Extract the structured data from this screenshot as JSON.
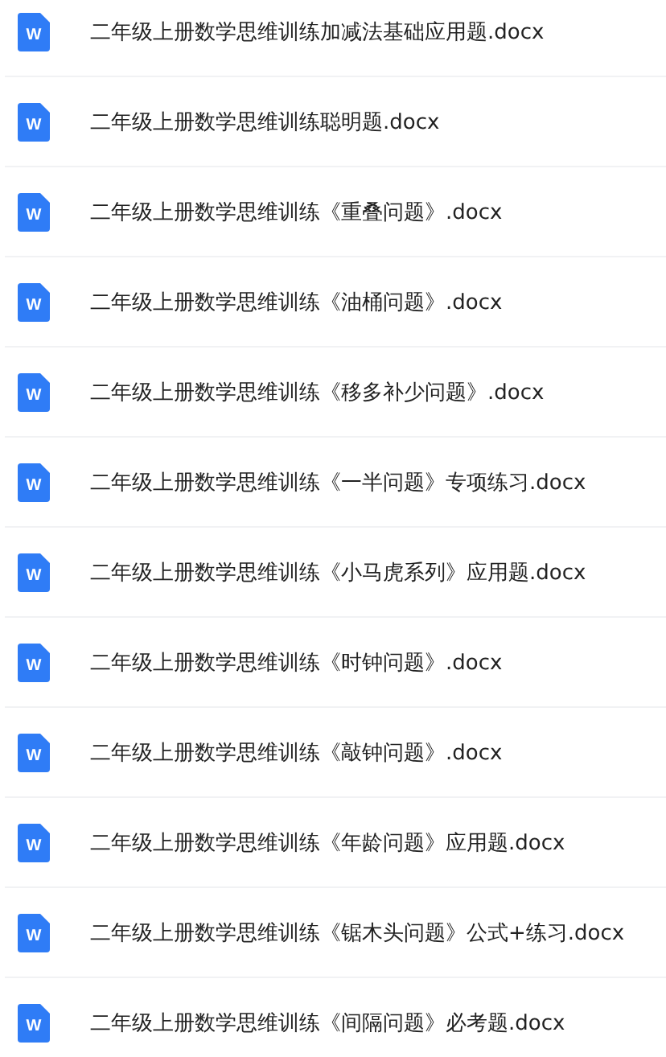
{
  "files": [
    {
      "icon_label": "W",
      "name": "二年级上册数学思维训练加减法基础应用题.docx"
    },
    {
      "icon_label": "W",
      "name": "二年级上册数学思维训练聪明题.docx"
    },
    {
      "icon_label": "W",
      "name": "二年级上册数学思维训练《重叠问题》.docx"
    },
    {
      "icon_label": "W",
      "name": "二年级上册数学思维训练《油桶问题》.docx"
    },
    {
      "icon_label": "W",
      "name": "二年级上册数学思维训练《移多补少问题》.docx"
    },
    {
      "icon_label": "W",
      "name": "二年级上册数学思维训练《一半问题》专项练习.docx"
    },
    {
      "icon_label": "W",
      "name": "二年级上册数学思维训练《小马虎系列》应用题.docx"
    },
    {
      "icon_label": "W",
      "name": "二年级上册数学思维训练《时钟问题》.docx"
    },
    {
      "icon_label": "W",
      "name": "二年级上册数学思维训练《敲钟问题》.docx"
    },
    {
      "icon_label": "W",
      "name": "二年级上册数学思维训练《年龄问题》应用题.docx"
    },
    {
      "icon_label": "W",
      "name": "二年级上册数学思维训练《锯木头问题》公式+练习.docx"
    },
    {
      "icon_label": "W",
      "name": "二年级上册数学思维训练《间隔问题》必考题.docx"
    }
  ]
}
